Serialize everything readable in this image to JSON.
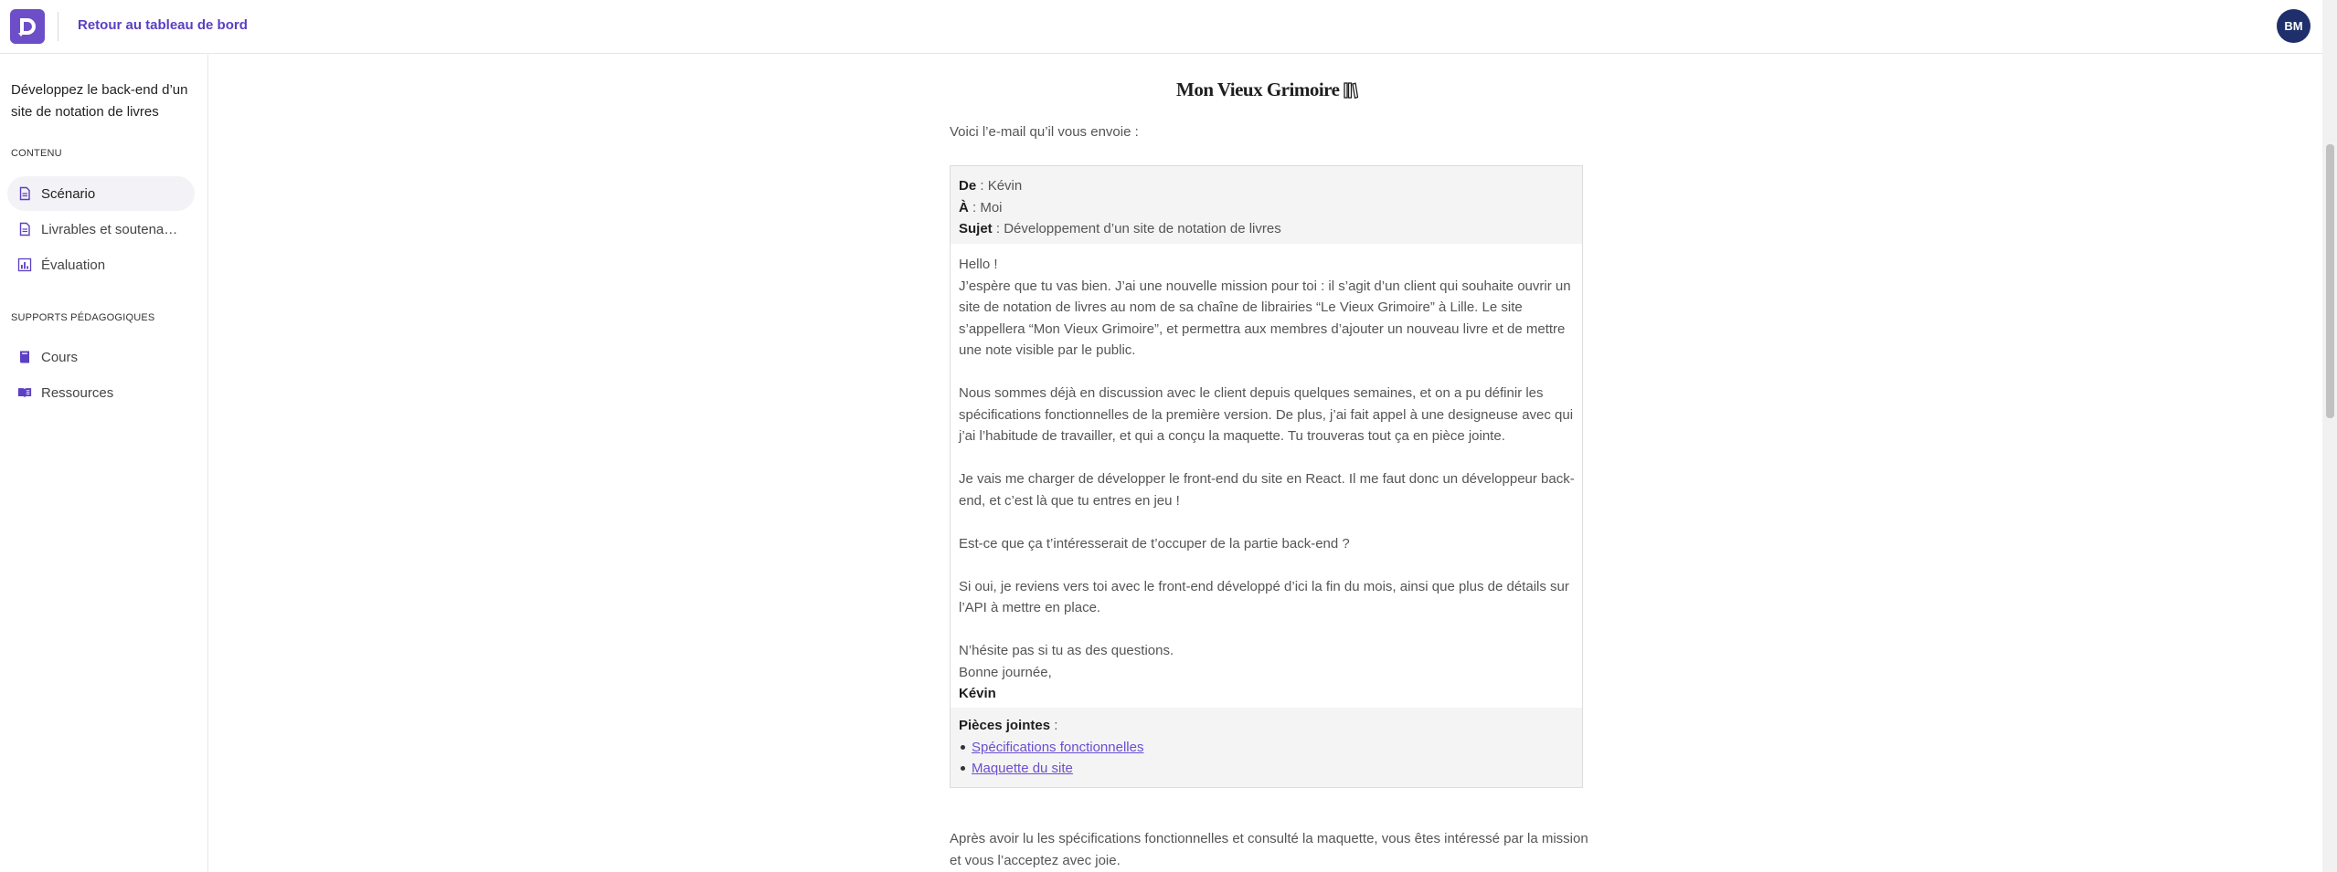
{
  "header": {
    "back_link": "Retour au tableau de bord",
    "avatar_initials": "BM",
    "brand_color": "#6d4ec9"
  },
  "sidebar": {
    "course_title": "Développez le back-end d’un site de notation de livres",
    "content_section": "CONTENU",
    "content_items": [
      {
        "label": "Scénario",
        "icon": "document-icon",
        "active": true
      },
      {
        "label": "Livrables et soutena…",
        "icon": "document-icon",
        "active": false
      },
      {
        "label": "Évaluation",
        "icon": "chart-icon",
        "active": false
      }
    ],
    "resources_section": "SUPPORTS PÉDAGOGIQUES",
    "resource_items": [
      {
        "label": "Cours",
        "icon": "book-icon"
      },
      {
        "label": "Ressources",
        "icon": "open-book-icon"
      }
    ]
  },
  "main": {
    "brand": "Mon Vieux Grimoire",
    "intro": "Voici l’e-mail qu’il vous envoie :",
    "email": {
      "from_label": "De",
      "from_value": " : Kévin",
      "to_label": "À",
      "to_value": " : Moi",
      "subject_label": "Sujet",
      "subject_value": " : Développement d’un site de notation de livres",
      "greeting": "Hello !",
      "para1": "J’espère que tu vas bien. J’ai une nouvelle mission pour toi : il s’agit d’un client qui souhaite ouvrir un site de notation de livres au nom de sa chaîne de librairies “Le Vieux Grimoire” à Lille. Le site s’appellera “Mon Vieux Grimoire”, et permettra aux membres d’ajouter un nouveau livre et de mettre une note visible par le public.",
      "para2": "Nous sommes déjà en discussion avec le client depuis quelques semaines, et on a pu définir les spécifications fonctionnelles de la première version. De plus, j’ai fait appel à une designeuse avec qui j’ai l’habitude de travailler, et qui a conçu la maquette. Tu trouveras tout ça en pièce jointe.",
      "para3": "Je vais me charger de développer le front-end du site en React. Il me faut donc un développeur back-end, et c’est là que tu entres en jeu !",
      "para4": "Est-ce que ça t’intéresserait de t’occuper de la partie back-end ?",
      "para5": "Si oui, je reviens vers toi avec le front-end développé d’ici la fin du mois, ainsi que plus de détails sur l’API à mettre en place.",
      "para6": "N’hésite pas si tu as des questions.",
      "closing": "Bonne journée,",
      "signature": "Kévin",
      "attachments_label": "Pièces jointes",
      "attachments_suffix": " :",
      "attachments": [
        "Spécifications fonctionnelles",
        "Maquette du site"
      ]
    },
    "outro": "Après avoir lu les spécifications fonctionnelles et consulté la maquette, vous êtes intéressé par la mission et vous l’acceptez avec joie."
  }
}
